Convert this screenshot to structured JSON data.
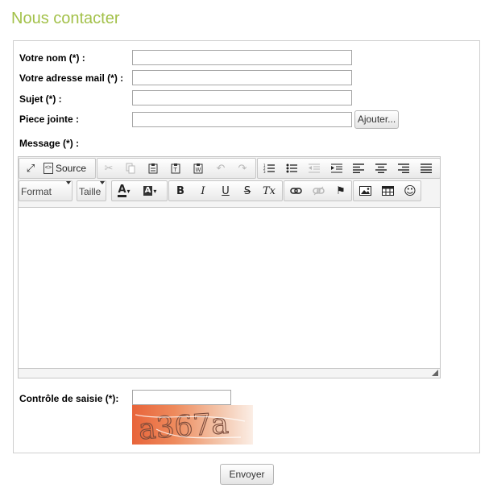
{
  "page": {
    "title": "Nous contacter"
  },
  "form": {
    "name_label": "Votre nom (*) :",
    "email_label": "Votre adresse mail (*) :",
    "subject_label": "Sujet (*) :",
    "attachment_label": "Piece jointe :",
    "attachment_button": "Ajouter...",
    "message_label": "Message (*) :",
    "captcha_label": "Contrôle de saisie (*):",
    "captcha_text": "a367a",
    "submit_label": "Envoyer",
    "name_value": "",
    "email_value": "",
    "subject_value": "",
    "attachment_value": "",
    "captcha_value": ""
  },
  "editor": {
    "source_label": "Source",
    "format_label": "Format",
    "size_label": "Taille",
    "icons": {
      "maximize": "⤢",
      "cut": "✂",
      "undo": "↶",
      "redo": "↷",
      "bold": "B",
      "italic": "I",
      "underline": "U",
      "strike": "S",
      "remove_format": "Tx",
      "text_color": "A",
      "bg_color": "A",
      "smiley": "☺",
      "flag": "⚑"
    }
  }
}
